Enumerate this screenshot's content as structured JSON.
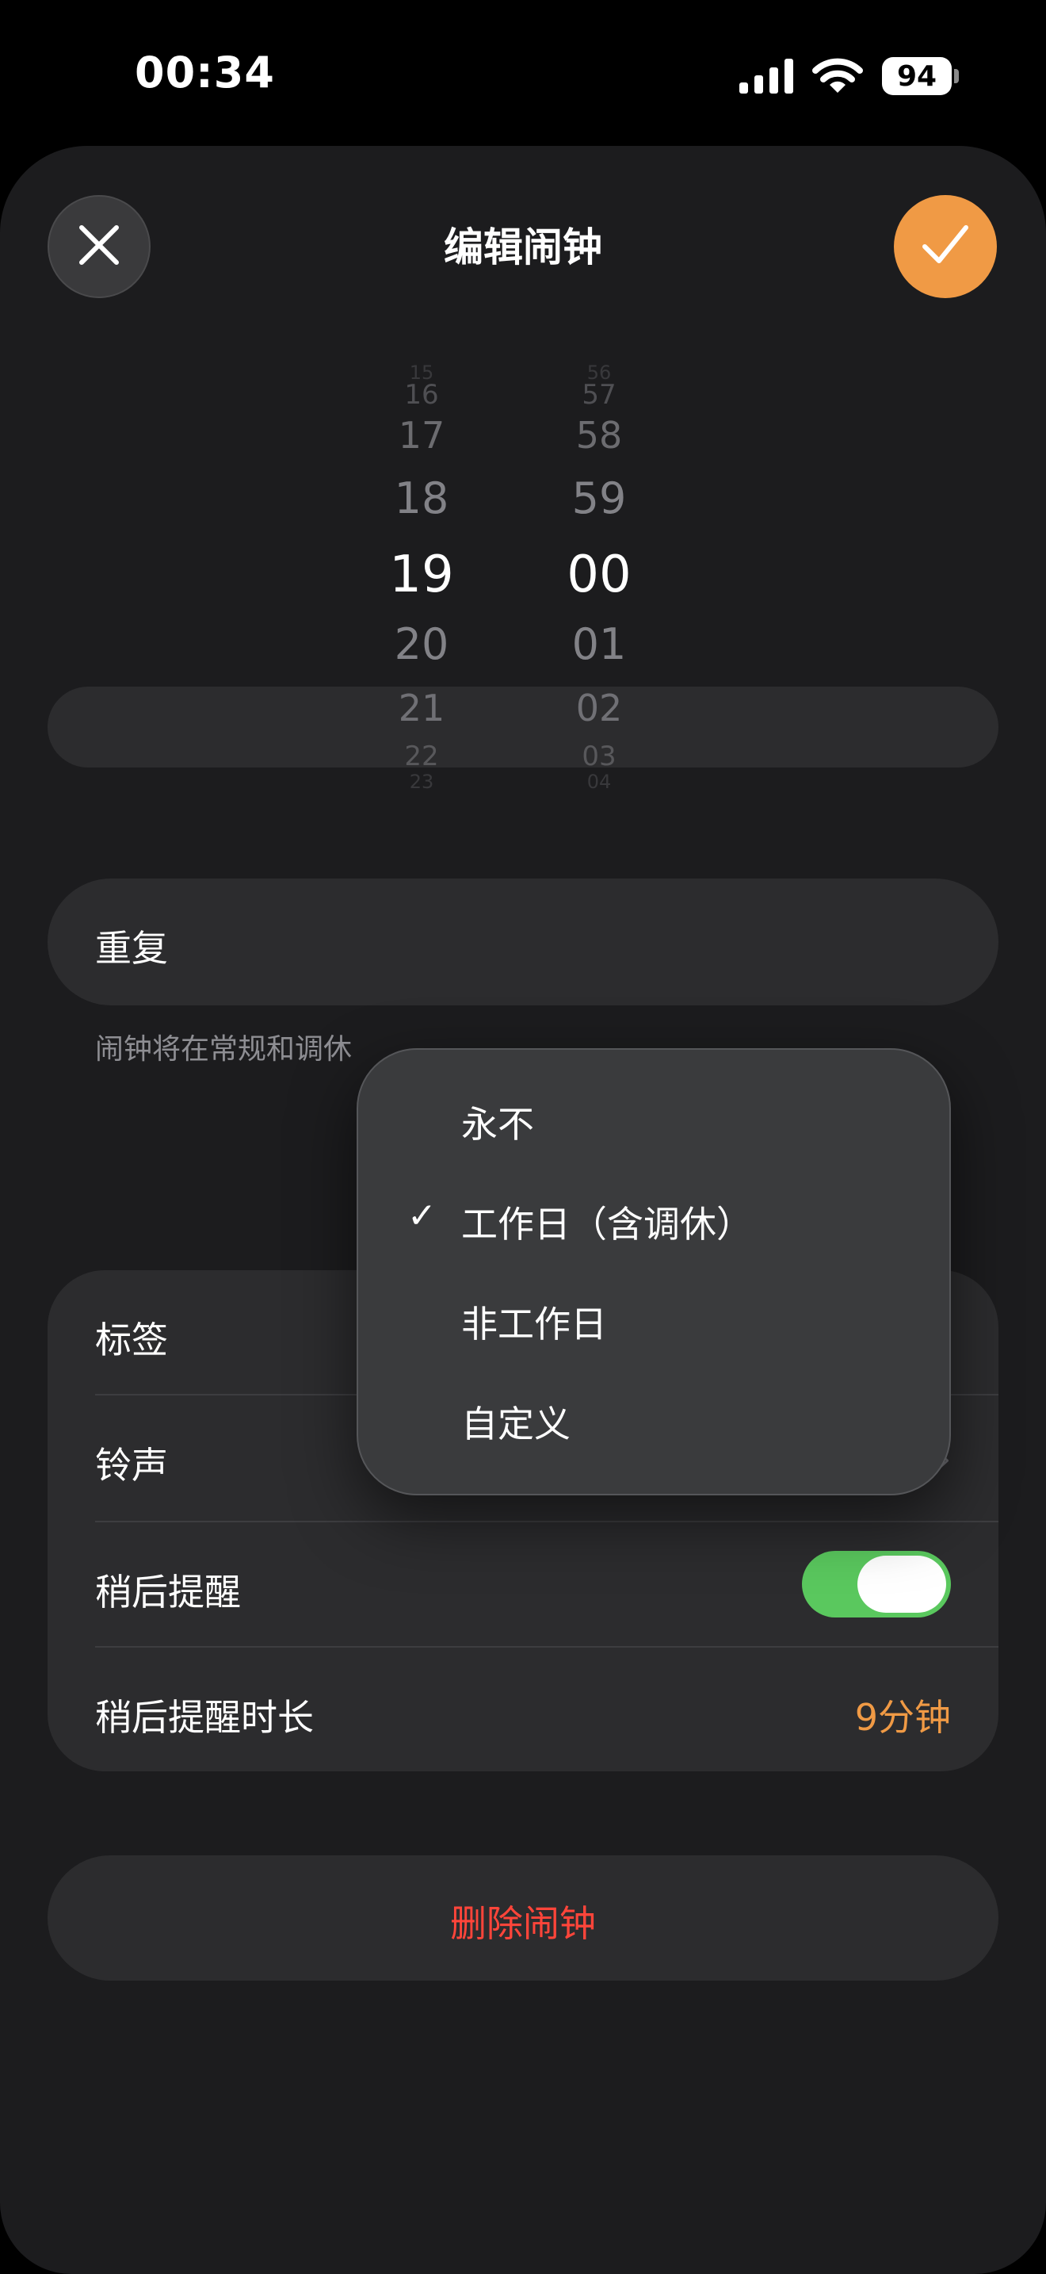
{
  "status_bar": {
    "time": "00:34",
    "battery": "94"
  },
  "header": {
    "title": "编辑闹钟",
    "close_icon": "close-icon",
    "confirm_icon": "checkmark-icon",
    "accent_color": "#f09a45"
  },
  "time_picker": {
    "hours": [
      "15",
      "16",
      "17",
      "18",
      "19",
      "20",
      "21",
      "22",
      "23"
    ],
    "minutes": [
      "56",
      "57",
      "58",
      "59",
      "00",
      "01",
      "02",
      "03",
      "04"
    ],
    "selected_hour": "19",
    "selected_minute": "00"
  },
  "repeat": {
    "label": "重复",
    "hint": "闹钟将在常规和调休"
  },
  "repeat_menu": {
    "items": [
      {
        "label": "永不",
        "checked": false
      },
      {
        "label": "工作日（含调休）",
        "checked": true
      },
      {
        "label": "非工作日",
        "checked": false
      },
      {
        "label": "自定义",
        "checked": false
      }
    ],
    "check_glyph": "✓"
  },
  "settings": {
    "label_row": {
      "label": "标签"
    },
    "sound_row": {
      "label": "铃声"
    },
    "snooze_row": {
      "label": "稍后提醒",
      "enabled": true,
      "toggle_color": "#5ac85e"
    },
    "snooze_duration_row": {
      "label": "稍后提醒时长",
      "value": "9分钟"
    }
  },
  "delete": {
    "label": "删除闹钟",
    "color": "#ff453a"
  }
}
